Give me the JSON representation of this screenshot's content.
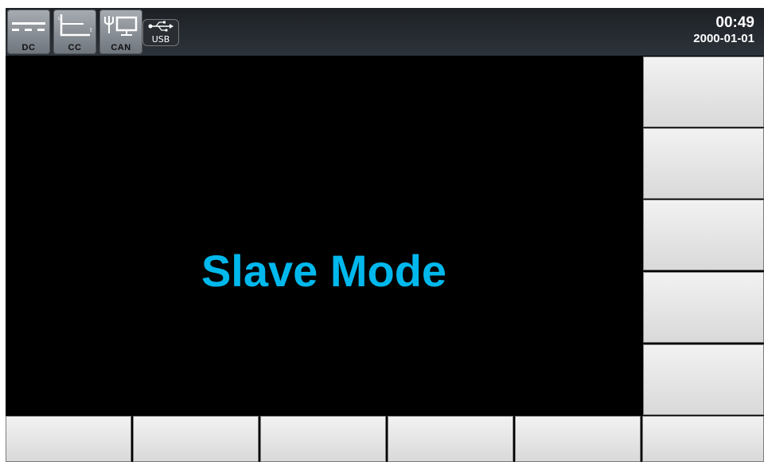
{
  "status_bar": {
    "indicators": [
      {
        "label": "DC",
        "icon": "dc-icon"
      },
      {
        "label": "CC",
        "icon": "cc-curve-icon"
      },
      {
        "label": "CAN",
        "icon": "can-network-icon"
      }
    ],
    "usb": {
      "label": "USB",
      "icon": "usb-icon"
    },
    "time": "00:49",
    "date": "2000-01-01"
  },
  "main": {
    "mode_text": "Slave Mode",
    "mode_color": "#00b8ec"
  },
  "softkeys": {
    "side": [
      "",
      "",
      "",
      "",
      ""
    ],
    "bottom": [
      "",
      "",
      "",
      "",
      "",
      ""
    ]
  }
}
